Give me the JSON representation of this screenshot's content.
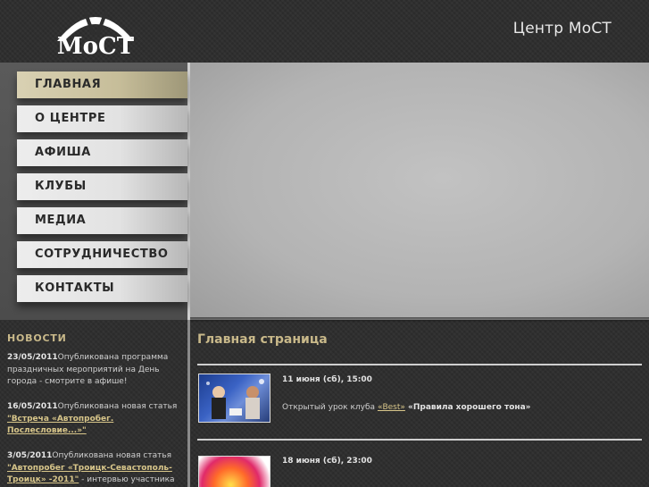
{
  "header": {
    "logo_text": "МоСТ",
    "site_title": "Центр МоСТ"
  },
  "nav": {
    "items": [
      {
        "label": "ГЛАВНАЯ",
        "active": true
      },
      {
        "label": "О ЦЕНТРЕ",
        "active": false
      },
      {
        "label": "АФИША",
        "active": false
      },
      {
        "label": "КЛУБЫ",
        "active": false
      },
      {
        "label": "МЕДИА",
        "active": false
      },
      {
        "label": "СОТРУДНИЧЕСТВО",
        "active": false
      },
      {
        "label": "КОНТАКТЫ",
        "active": false
      }
    ]
  },
  "news": {
    "heading": "НОВОСТИ",
    "items": [
      {
        "date": "23/05/2011",
        "text": "Опубликована программа праздничных мероприятий на День города - смотрите в афише!",
        "link": "",
        "after": ""
      },
      {
        "date": "16/05/2011",
        "text": "Опубликована новая статья ",
        "link": "\"Встреча «Автопробег. Послесловие...»\"",
        "after": ""
      },
      {
        "date": "3/05/2011",
        "text": "Опубликована новая статья ",
        "link": "\"Автопробег «Троицк-Севастополь-Троицк» -2011\"",
        "after": " - интервью участника"
      }
    ]
  },
  "main": {
    "page_title": "Главная страница",
    "events": [
      {
        "date": "11 июня (сб), 15:00",
        "prefix": "Открытый урок клуба ",
        "club": "«Best»",
        "title": " «Правила хорошего тона»"
      },
      {
        "date": "18 июня (сб), 23:00",
        "prefix": "",
        "club": "",
        "title": ""
      }
    ]
  },
  "colors": {
    "accent": "#c9b98a",
    "link": "#d8c68a",
    "active_nav": "#c6bd99"
  }
}
